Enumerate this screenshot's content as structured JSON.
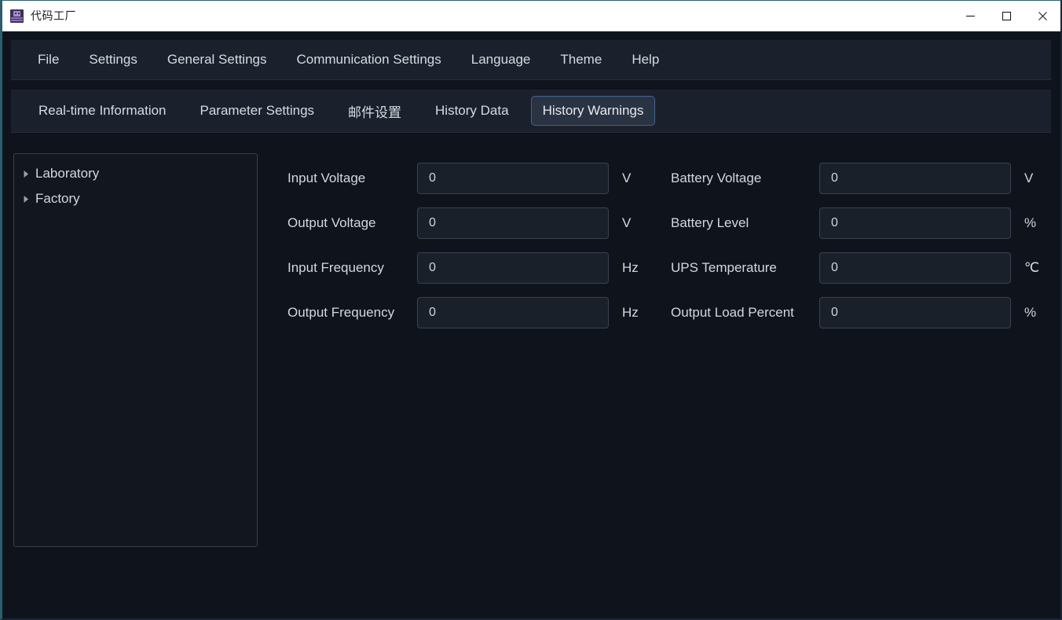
{
  "window": {
    "title": "代码工厂",
    "icon": "app-robot-icon",
    "controls": {
      "minimize": "minimize-icon",
      "maximize": "maximize-icon",
      "close": "close-icon"
    }
  },
  "menu": {
    "items": [
      {
        "label": "File"
      },
      {
        "label": "Settings"
      },
      {
        "label": "General Settings"
      },
      {
        "label": "Communication Settings"
      },
      {
        "label": "Language"
      },
      {
        "label": "Theme"
      },
      {
        "label": "Help"
      }
    ]
  },
  "tabs": {
    "items": [
      {
        "label": "Real-time Information",
        "active": false,
        "cjk": false
      },
      {
        "label": "Parameter Settings",
        "active": false,
        "cjk": false
      },
      {
        "label": "邮件设置",
        "active": false,
        "cjk": true
      },
      {
        "label": "History Data",
        "active": false,
        "cjk": false
      },
      {
        "label": "History Warnings",
        "active": true,
        "cjk": false
      }
    ],
    "active_label": "History Warnings"
  },
  "sidebar": {
    "nodes": [
      {
        "label": "Laboratory",
        "expanded": false,
        "arrow": "chevron-right-icon"
      },
      {
        "label": "Factory",
        "expanded": false,
        "arrow": "chevron-right-icon"
      }
    ]
  },
  "form": {
    "left_column": [
      {
        "label": "Input Voltage",
        "value": "0",
        "unit": "V"
      },
      {
        "label": "Output Voltage",
        "value": "0",
        "unit": "V"
      },
      {
        "label": "Input Frequency",
        "value": "0",
        "unit": "Hz"
      },
      {
        "label": "Output Frequency",
        "value": "0",
        "unit": "Hz"
      }
    ],
    "right_column": [
      {
        "label": "Battery Voltage",
        "value": "0",
        "unit": "V"
      },
      {
        "label": "Battery Level",
        "value": "0",
        "unit": "%"
      },
      {
        "label": "UPS Temperature",
        "value": "0",
        "unit": "℃"
      },
      {
        "label": "Output Load Percent",
        "value": "0",
        "unit": "%"
      }
    ]
  },
  "colors": {
    "window_background": "#0f141c",
    "bar_background": "#1b212c",
    "title_bar": "#ffffff",
    "accent_border": "#2a5f70",
    "active_tab_border": "#3f6490",
    "active_tab_fill": "#2a3342",
    "input_fill": "#1a202a",
    "input_border": "#3a4150",
    "text_primary": "#d3d7de"
  }
}
